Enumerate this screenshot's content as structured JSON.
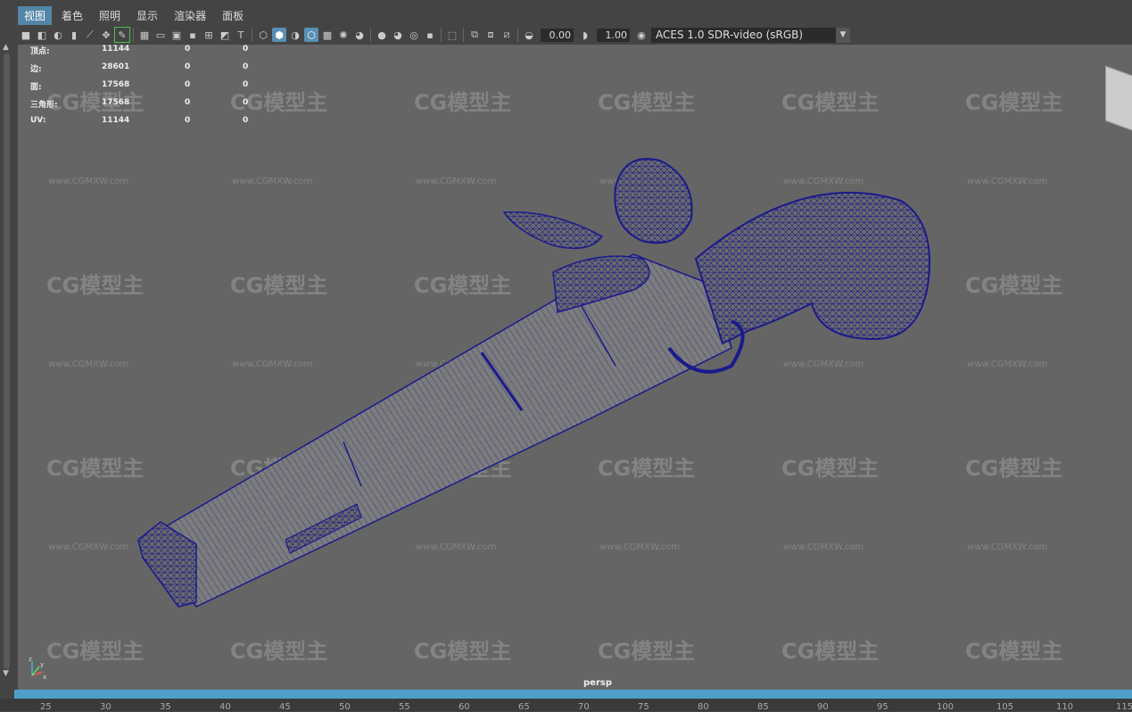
{
  "menu": {
    "items": [
      "视图",
      "着色",
      "照明",
      "显示",
      "渲染器",
      "面板"
    ]
  },
  "toolbar": {
    "exposure": "0.00",
    "gamma": "1.00",
    "color_space": "ACES 1.0 SDR-video (sRGB)"
  },
  "hud": {
    "rows": [
      {
        "label": "顶点:",
        "c1": "11144",
        "c2": "0",
        "c3": "0"
      },
      {
        "label": "边:",
        "c1": "28601",
        "c2": "0",
        "c3": "0"
      },
      {
        "label": "面:",
        "c1": "17568",
        "c2": "0",
        "c3": "0"
      },
      {
        "label": "三角形:",
        "c1": "17568",
        "c2": "0",
        "c3": "0"
      },
      {
        "label": "UV:",
        "c1": "11144",
        "c2": "0",
        "c3": "0"
      }
    ]
  },
  "watermark": {
    "logo": "CG模型主",
    "url": "www.CGMXW.com"
  },
  "camera_label": "persp",
  "axis": {
    "x": "x",
    "y": "y",
    "z": "z"
  },
  "timeline": {
    "ticks": [
      "25",
      "30",
      "35",
      "40",
      "45",
      "50",
      "55",
      "60",
      "65",
      "70",
      "75",
      "80",
      "85",
      "90",
      "95",
      "100",
      "105",
      "110",
      "115"
    ]
  },
  "colors": {
    "accent": "#5285a6",
    "viewport_bg": "#656565",
    "wireframe": "#1a1a8c",
    "timeline": "#4e9ec9"
  }
}
